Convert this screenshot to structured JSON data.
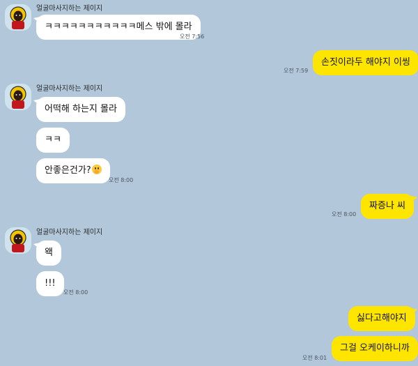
{
  "colors": {
    "background": "#b2c7d9",
    "incoming_bubble": "#ffffff",
    "outgoing_bubble": "#fee500"
  },
  "sender_name": "얼굴마사지하는 제이지",
  "messages": {
    "g1m1": {
      "text": "ㅋㅋㅋㅋㅋㅋㅋㅋㅋㅋㅋ메스 밖에 몰라",
      "time": "오전 7:56"
    },
    "o1m1": {
      "text": "손짓이라두 해야지 이씽",
      "time": "오전 7:59"
    },
    "g2m1": {
      "text": "어떡해 하는지 몰라"
    },
    "g2m2": {
      "text": "ㅋㅋ"
    },
    "g2m3": {
      "text": "안좋은건가?",
      "emoji_icon": "thinking-face-icon",
      "time": "오전 8:00"
    },
    "o2m1": {
      "text": "짜증나  씨",
      "time": "오전 8:00"
    },
    "g3m1": {
      "text": "왝"
    },
    "g3m2": {
      "text": "!!!",
      "time": "오전 8:00"
    },
    "o3m1": {
      "text": "싫다고해야지"
    },
    "o3m2": {
      "text": "그걸 오케이하니까",
      "time": "오전 8:01"
    }
  },
  "avatar_icon": "profile-avatar-icon"
}
